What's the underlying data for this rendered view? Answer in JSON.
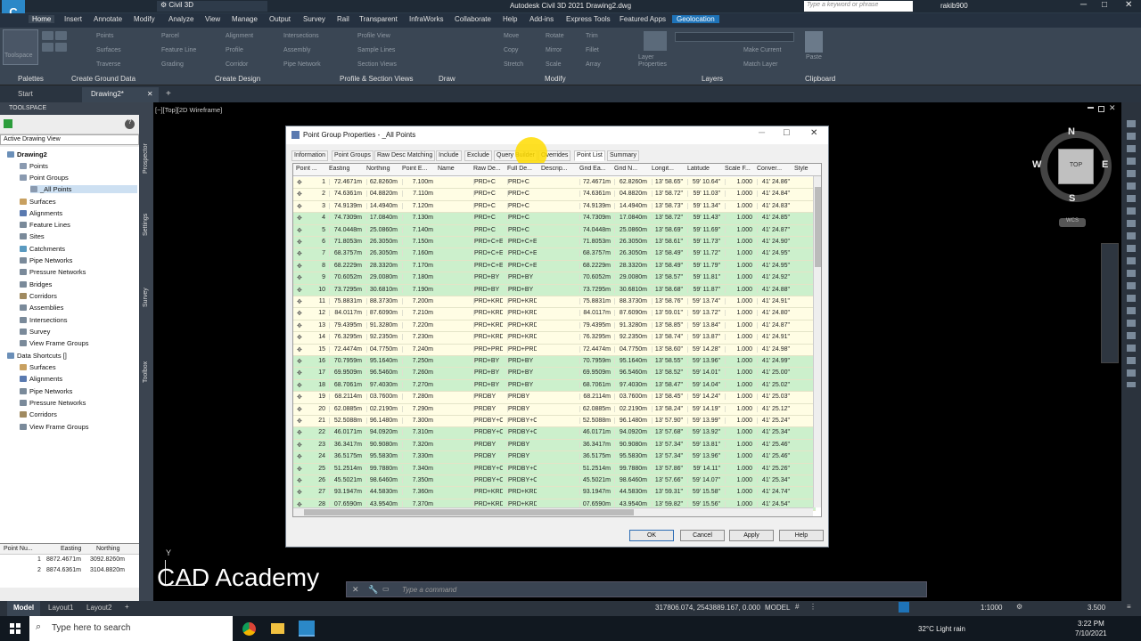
{
  "app": {
    "title": "Autodesk Civil 3D 2021    Drawing2.dwg",
    "workspace": "Civil 3D",
    "search_placeholder": "Type a keyword or phrase",
    "user": "rakib900"
  },
  "menu": [
    "Home",
    "Insert",
    "Annotate",
    "Modify",
    "Analyze",
    "View",
    "Manage",
    "Output",
    "Survey",
    "Rail",
    "Transparent",
    "InfraWorks",
    "Collaborate",
    "Help",
    "Add-ins",
    "Express Tools",
    "Featured Apps",
    "Geolocation"
  ],
  "ribbon": {
    "toolspace_label": "Toolspace",
    "panels": [
      "Palettes",
      "Create Ground Data",
      "Create Design",
      "Profile & Section Views",
      "Draw",
      "Modify",
      "Layers",
      "Clipboard"
    ],
    "tools": [
      "Points",
      "Surfaces",
      "Traverse",
      "Parcel",
      "Feature Line",
      "Grading",
      "Alignment",
      "Profile",
      "Corridor",
      "Intersections",
      "Assembly",
      "Pipe Network",
      "Profile View",
      "Sample Lines",
      "Section Views",
      "Move",
      "Copy",
      "Stretch",
      "Rotate",
      "Mirror",
      "Scale",
      "Trim",
      "Fillet",
      "Array",
      "Layer Properties",
      "Make Current",
      "Match Layer",
      "Paste"
    ]
  },
  "doc_tabs": [
    "Start",
    "Drawing2*"
  ],
  "toolspace": {
    "title": "TOOLSPACE",
    "dropdown": "Active Drawing View",
    "tree": [
      "Drawing2",
      "Points",
      "Point Groups",
      "_All Points",
      "Surfaces",
      "Alignments",
      "Feature Lines",
      "Sites",
      "Catchments",
      "Pipe Networks",
      "Pressure Networks",
      "Bridges",
      "Corridors",
      "Assemblies",
      "Intersections",
      "Survey",
      "View Frame Groups",
      "Data Shortcuts []",
      "Surfaces",
      "Alignments",
      "Pipe Networks",
      "Pressure Networks",
      "Corridors",
      "View Frame Groups"
    ],
    "side_tabs": [
      "Prospector",
      "Settings",
      "Survey",
      "Toolbox"
    ]
  },
  "mini_table": {
    "headers": [
      "Point Nu...",
      "Easting",
      "Northing"
    ],
    "rows": [
      [
        "1",
        "8872.4671m",
        "3092.8260m"
      ],
      [
        "2",
        "8874.6361m",
        "3104.8820m"
      ]
    ]
  },
  "viewport": {
    "label": "[−][Top][2D Wireframe]",
    "watermark": "CAD Academy",
    "viewcube": {
      "top": "TOP",
      "n": "N",
      "s": "S",
      "e": "E",
      "w": "W",
      "wcs": "WCS"
    }
  },
  "dialog": {
    "title": "Point Group Properties - _All Points",
    "tabs": [
      "Information",
      "Point Groups",
      "Raw Desc Matching",
      "Include",
      "Exclude",
      "Query Builder",
      "Overrides",
      "Point List",
      "Summary"
    ],
    "columns": [
      "Point ...",
      "Easting",
      "Northing",
      "Point E...",
      "Name",
      "Raw De...",
      "Full De...",
      "Descrip...",
      "Grid Ea...",
      "Grid N...",
      "Longit...",
      "Latitude",
      "Scale F...",
      "Conver...",
      "Style"
    ],
    "rows": [
      [
        "1",
        "72.4671m",
        "62.8260m",
        "7.100m",
        "",
        "PRD+C",
        "PRD+C",
        "",
        "72.4671m",
        "62.8260m",
        "13' 58.65\"",
        "59' 10.64\"",
        "1.000",
        "41' 24.86\""
      ],
      [
        "2",
        "74.6361m",
        "04.8820m",
        "7.110m",
        "",
        "PRD+C",
        "PRD+C",
        "",
        "74.6361m",
        "04.8820m",
        "13' 58.72\"",
        "59' 11.03\"",
        "1.000",
        "41' 24.84\""
      ],
      [
        "3",
        "74.9139m",
        "14.4940m",
        "7.120m",
        "",
        "PRD+C",
        "PRD+C",
        "",
        "74.9139m",
        "14.4940m",
        "13' 58.73\"",
        "59' 11.34\"",
        "1.000",
        "41' 24.83\""
      ],
      [
        "4",
        "74.7309m",
        "17.0840m",
        "7.130m",
        "",
        "PRD+C",
        "PRD+C",
        "",
        "74.7309m",
        "17.0840m",
        "13' 58.72\"",
        "59' 11.43\"",
        "1.000",
        "41' 24.85\""
      ],
      [
        "5",
        "74.0448m",
        "25.0860m",
        "7.140m",
        "",
        "PRD+C",
        "PRD+C",
        "",
        "74.0448m",
        "25.0860m",
        "13' 58.69\"",
        "59' 11.69\"",
        "1.000",
        "41' 24.87\""
      ],
      [
        "6",
        "71.8053m",
        "26.3050m",
        "7.150m",
        "",
        "PRD+C+E",
        "PRD+C+E",
        "",
        "71.8053m",
        "26.3050m",
        "13' 58.61\"",
        "59' 11.73\"",
        "1.000",
        "41' 24.90\""
      ],
      [
        "7",
        "68.3757m",
        "26.3050m",
        "7.160m",
        "",
        "PRD+C+E",
        "PRD+C+E",
        "",
        "68.3757m",
        "26.3050m",
        "13' 58.49\"",
        "59' 11.72\"",
        "1.000",
        "41' 24.95\""
      ],
      [
        "8",
        "68.2229m",
        "28.3320m",
        "7.170m",
        "",
        "PRD+C+E",
        "PRD+C+E",
        "",
        "68.2229m",
        "28.3320m",
        "13' 58.49\"",
        "59' 11.79\"",
        "1.000",
        "41' 24.95\""
      ],
      [
        "9",
        "70.6052m",
        "29.0080m",
        "7.180m",
        "",
        "PRD+BY",
        "PRD+BY",
        "",
        "70.6052m",
        "29.0080m",
        "13' 58.57\"",
        "59' 11.81\"",
        "1.000",
        "41' 24.92\""
      ],
      [
        "10",
        "73.7295m",
        "30.6810m",
        "7.190m",
        "",
        "PRD+BY",
        "PRD+BY",
        "",
        "73.7295m",
        "30.6810m",
        "13' 58.68\"",
        "59' 11.87\"",
        "1.000",
        "41' 24.88\""
      ],
      [
        "11",
        "75.8831m",
        "88.3730m",
        "7.200m",
        "",
        "PRD+KRD",
        "PRD+KRD",
        "",
        "75.8831m",
        "88.3730m",
        "13' 58.76\"",
        "59' 13.74\"",
        "1.000",
        "41' 24.91\""
      ],
      [
        "12",
        "84.0117m",
        "87.6090m",
        "7.210m",
        "",
        "PRD+KRD",
        "PRD+KRD",
        "",
        "84.0117m",
        "87.6090m",
        "13' 59.01\"",
        "59' 13.72\"",
        "1.000",
        "41' 24.80\""
      ],
      [
        "13",
        "79.4395m",
        "91.3280m",
        "7.220m",
        "",
        "PRD+KRD",
        "PRD+KRD",
        "",
        "79.4395m",
        "91.3280m",
        "13' 58.85\"",
        "59' 13.84\"",
        "1.000",
        "41' 24.87\""
      ],
      [
        "14",
        "76.3295m",
        "92.2350m",
        "7.230m",
        "",
        "PRD+KRD",
        "PRD+KRD",
        "",
        "76.3295m",
        "92.2350m",
        "13' 58.74\"",
        "59' 13.87\"",
        "1.000",
        "41' 24.91\""
      ],
      [
        "15",
        "72.4474m",
        "04.7750m",
        "7.240m",
        "",
        "PRD+PRD",
        "PRD+PRD",
        "",
        "72.4474m",
        "04.7750m",
        "13' 58.60\"",
        "59' 14.28\"",
        "1.000",
        "41' 24.98\""
      ],
      [
        "16",
        "70.7959m",
        "95.1640m",
        "7.250m",
        "",
        "PRD+BY",
        "PRD+BY",
        "",
        "70.7959m",
        "95.1640m",
        "13' 58.55\"",
        "59' 13.96\"",
        "1.000",
        "41' 24.99\""
      ],
      [
        "17",
        "69.9509m",
        "96.5460m",
        "7.260m",
        "",
        "PRD+BY",
        "PRD+BY",
        "",
        "69.9509m",
        "96.5460m",
        "13' 58.52\"",
        "59' 14.01\"",
        "1.000",
        "41' 25.00\""
      ],
      [
        "18",
        "68.7061m",
        "97.4030m",
        "7.270m",
        "",
        "PRD+BY",
        "PRD+BY",
        "",
        "68.7061m",
        "97.4030m",
        "13' 58.47\"",
        "59' 14.04\"",
        "1.000",
        "41' 25.02\""
      ],
      [
        "19",
        "68.2114m",
        "03.7600m",
        "7.280m",
        "",
        "PRDBY",
        "PRDBY",
        "",
        "68.2114m",
        "03.7600m",
        "13' 58.45\"",
        "59' 14.24\"",
        "1.000",
        "41' 25.03\""
      ],
      [
        "20",
        "62.0885m",
        "02.2190m",
        "7.290m",
        "",
        "PRDBY",
        "PRDBY",
        "",
        "62.0885m",
        "02.2190m",
        "13' 58.24\"",
        "59' 14.19\"",
        "1.000",
        "41' 25.12\""
      ],
      [
        "21",
        "52.5088m",
        "96.1480m",
        "7.300m",
        "",
        "PRDBY+C",
        "PRDBY+C",
        "",
        "52.5088m",
        "96.1480m",
        "13' 57.90\"",
        "59' 13.99\"",
        "1.000",
        "41' 25.24\""
      ],
      [
        "22",
        "46.0171m",
        "94.0920m",
        "7.310m",
        "",
        "PRDBY+C",
        "PRDBY+C",
        "",
        "46.0171m",
        "94.0920m",
        "13' 57.68\"",
        "59' 13.92\"",
        "1.000",
        "41' 25.34\""
      ],
      [
        "23",
        "36.3417m",
        "90.9080m",
        "7.320m",
        "",
        "PRDBY",
        "PRDBY",
        "",
        "36.3417m",
        "90.9080m",
        "13' 57.34\"",
        "59' 13.81\"",
        "1.000",
        "41' 25.46\""
      ],
      [
        "24",
        "36.5175m",
        "95.5830m",
        "7.330m",
        "",
        "PRDBY",
        "PRDBY",
        "",
        "36.5175m",
        "95.5830m",
        "13' 57.34\"",
        "59' 13.96\"",
        "1.000",
        "41' 25.46\""
      ],
      [
        "25",
        "51.2514m",
        "99.7880m",
        "7.340m",
        "",
        "PRDBY+C",
        "PRDBY+C",
        "",
        "51.2514m",
        "99.7880m",
        "13' 57.86\"",
        "59' 14.11\"",
        "1.000",
        "41' 25.26\""
      ],
      [
        "26",
        "45.5021m",
        "98.6460m",
        "7.350m",
        "",
        "PRDBY+C",
        "PRDBY+C",
        "",
        "45.5021m",
        "98.6460m",
        "13' 57.66\"",
        "59' 14.07\"",
        "1.000",
        "41' 25.34\""
      ],
      [
        "27",
        "93.1947m",
        "44.5830m",
        "7.360m",
        "",
        "PRD+KRD",
        "PRD+KRD",
        "",
        "93.1947m",
        "44.5830m",
        "13' 59.31\"",
        "59' 15.58\"",
        "1.000",
        "41' 24.74\""
      ],
      [
        "28",
        "07.6590m",
        "43.9540m",
        "7.370m",
        "",
        "PRD+KRD",
        "PRD+KRD",
        "",
        "07.6590m",
        "43.9540m",
        "13' 59.82\"",
        "59' 15.56\"",
        "1.000",
        "41' 24.54\""
      ]
    ],
    "buttons": [
      "OK",
      "Cancel",
      "Apply",
      "Help"
    ]
  },
  "command": {
    "placeholder": "Type a command"
  },
  "layout_tabs": [
    "Model",
    "Layout1",
    "Layout2"
  ],
  "status": {
    "coords": "317806.074, 2543889.167, 0.000",
    "mode": "MODEL",
    "scale": "1:1000",
    "value": "3.500"
  },
  "taskbar": {
    "search": "Type here to search",
    "weather": "32°C  Light rain",
    "time": "3:22 PM",
    "date": "7/10/2021"
  }
}
